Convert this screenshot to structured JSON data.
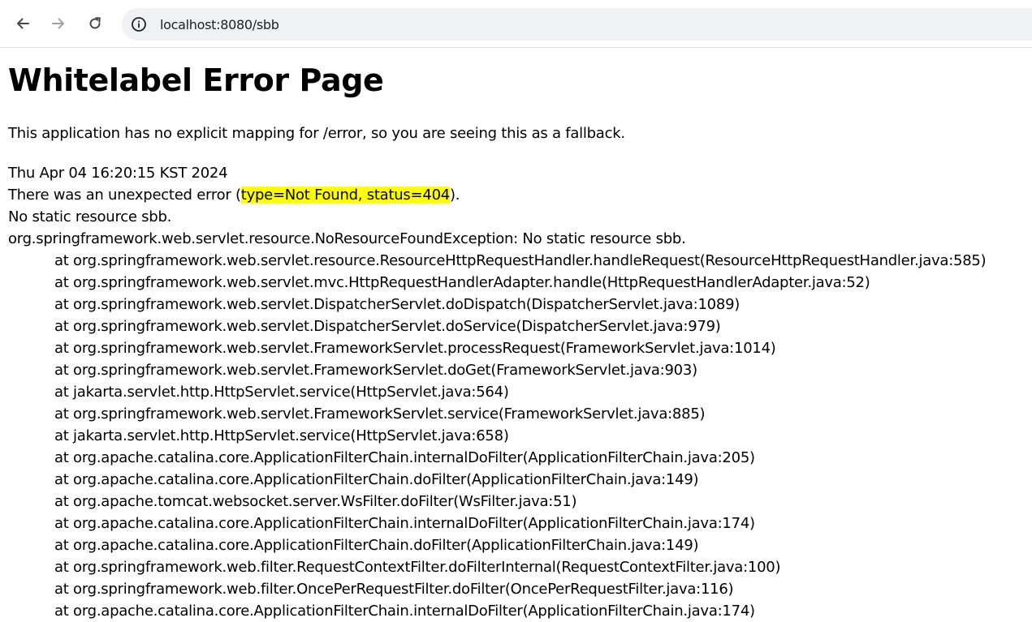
{
  "browser": {
    "url": "localhost:8080/sbb",
    "icons": {
      "back": "arrow-left-icon",
      "forward": "arrow-right-icon",
      "reload": "reload-icon",
      "site_info": "info-circle-icon"
    }
  },
  "page": {
    "title": "Whitelabel Error Page",
    "fallback_message": "This application has no explicit mapping for /error, so you are seeing this as a fallback.",
    "timestamp": "Thu Apr 04 16:20:15 KST 2024",
    "error_prefix": "There was an unexpected error (",
    "error_highlight": "type=Not Found, status=404",
    "error_suffix": ").",
    "message": "No static resource sbb.",
    "exception": "org.springframework.web.servlet.resource.NoResourceFoundException: No static resource sbb.",
    "stack_trace": [
      "at org.springframework.web.servlet.resource.ResourceHttpRequestHandler.handleRequest(ResourceHttpRequestHandler.java:585)",
      "at org.springframework.web.servlet.mvc.HttpRequestHandlerAdapter.handle(HttpRequestHandlerAdapter.java:52)",
      "at org.springframework.web.servlet.DispatcherServlet.doDispatch(DispatcherServlet.java:1089)",
      "at org.springframework.web.servlet.DispatcherServlet.doService(DispatcherServlet.java:979)",
      "at org.springframework.web.servlet.FrameworkServlet.processRequest(FrameworkServlet.java:1014)",
      "at org.springframework.web.servlet.FrameworkServlet.doGet(FrameworkServlet.java:903)",
      "at jakarta.servlet.http.HttpServlet.service(HttpServlet.java:564)",
      "at org.springframework.web.servlet.FrameworkServlet.service(FrameworkServlet.java:885)",
      "at jakarta.servlet.http.HttpServlet.service(HttpServlet.java:658)",
      "at org.apache.catalina.core.ApplicationFilterChain.internalDoFilter(ApplicationFilterChain.java:205)",
      "at org.apache.catalina.core.ApplicationFilterChain.doFilter(ApplicationFilterChain.java:149)",
      "at org.apache.tomcat.websocket.server.WsFilter.doFilter(WsFilter.java:51)",
      "at org.apache.catalina.core.ApplicationFilterChain.internalDoFilter(ApplicationFilterChain.java:174)",
      "at org.apache.catalina.core.ApplicationFilterChain.doFilter(ApplicationFilterChain.java:149)",
      "at org.springframework.web.filter.RequestContextFilter.doFilterInternal(RequestContextFilter.java:100)",
      "at org.springframework.web.filter.OncePerRequestFilter.doFilter(OncePerRequestFilter.java:116)",
      "at org.apache.catalina.core.ApplicationFilterChain.internalDoFilter(ApplicationFilterChain.java:174)"
    ]
  },
  "colors": {
    "highlight": "#ffff00",
    "omnibox_bg": "#eff1f5",
    "icon_enabled": "#474747",
    "icon_disabled": "#a0a0a0"
  }
}
